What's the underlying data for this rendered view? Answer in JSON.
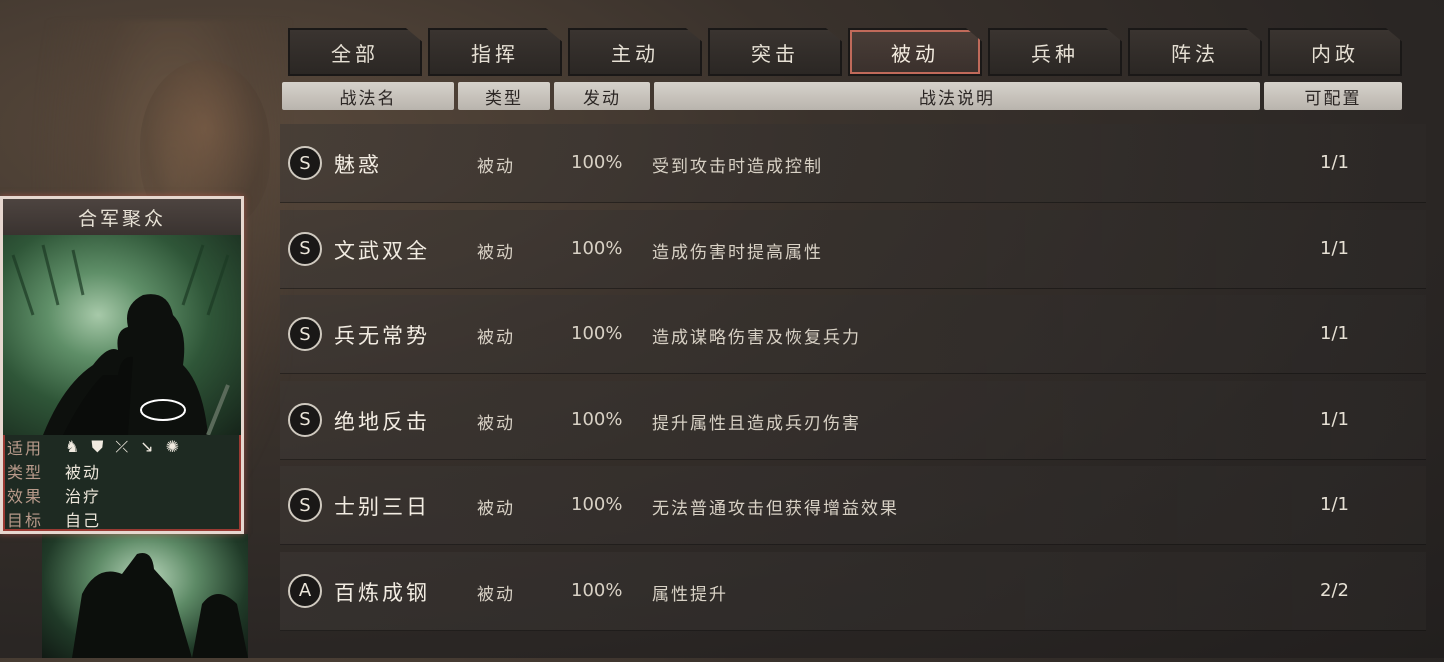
{
  "tabs": [
    {
      "label": "全部"
    },
    {
      "label": "指挥"
    },
    {
      "label": "主动"
    },
    {
      "label": "突击"
    },
    {
      "label": "被动",
      "active": true
    },
    {
      "label": "兵种"
    },
    {
      "label": "阵法"
    },
    {
      "label": "内政"
    }
  ],
  "columns": {
    "name": "战法名",
    "type": "类型",
    "rate": "发动",
    "desc": "战法说明",
    "config": "可配置"
  },
  "skills": [
    {
      "grade": "S",
      "name": "魅惑",
      "type": "被动",
      "rate": "100%",
      "desc": "受到攻击时造成控制",
      "config": "1/1"
    },
    {
      "grade": "S",
      "name": "文武双全",
      "type": "被动",
      "rate": "100%",
      "desc": "造成伤害时提高属性",
      "config": "1/1"
    },
    {
      "grade": "S",
      "name": "兵无常势",
      "type": "被动",
      "rate": "100%",
      "desc": "造成谋略伤害及恢复兵力",
      "config": "1/1"
    },
    {
      "grade": "S",
      "name": "绝地反击",
      "type": "被动",
      "rate": "100%",
      "desc": "提升属性且造成兵刃伤害",
      "config": "1/1"
    },
    {
      "grade": "S",
      "name": "士别三日",
      "type": "被动",
      "rate": "100%",
      "desc": "无法普通攻击但获得增益效果",
      "config": "1/1"
    },
    {
      "grade": "A",
      "name": "百炼成钢",
      "type": "被动",
      "rate": "100%",
      "desc": "属性提升",
      "config": "2/2"
    }
  ],
  "card": {
    "title": "合军聚众",
    "applicable_label": "适用",
    "applicable_icons": [
      "cavalry-icon",
      "shield-icon",
      "bow-icon",
      "spear-icon",
      "wheel-icon"
    ],
    "type_label": "类型",
    "type_value": "被动",
    "effect_label": "效果",
    "effect_value": "治疗",
    "target_label": "目标",
    "target_value": "自己"
  }
}
